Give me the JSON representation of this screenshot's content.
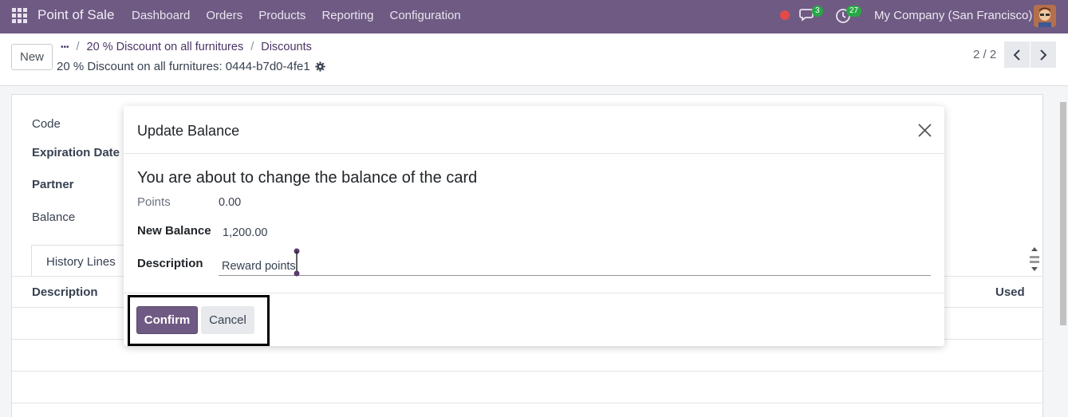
{
  "navbar": {
    "brand": "Point of Sale",
    "menu": [
      "Dashboard",
      "Orders",
      "Products",
      "Reporting",
      "Configuration"
    ],
    "chat_count": "3",
    "activity_count": "27",
    "company": "My Company (San Francisco)"
  },
  "control": {
    "new_label": "New",
    "breadcrumb_more": "•••",
    "breadcrumb": [
      "20 % Discount on all furnitures",
      "Discounts"
    ],
    "separator": "/",
    "record_title": "20 % Discount on all furnitures: 0444-b7d0-4fe1",
    "pager": "2 / 2"
  },
  "form": {
    "code_label": "Code",
    "expiration_label": "Expiration Date",
    "partner_label": "Partner",
    "balance_label": "Balance",
    "tab_history": "History Lines",
    "col_description": "Description",
    "col_used": "Used"
  },
  "dialog": {
    "title": "Update Balance",
    "heading": "You are about to change the balance of the card",
    "points_label": "Points",
    "points_value": "0.00",
    "new_balance_label": "New Balance",
    "new_balance_value": "1,200.00",
    "description_label": "Description",
    "description_value": "Reward points",
    "confirm_label": "Confirm",
    "cancel_label": "Cancel"
  },
  "colors": {
    "brand": "#6f5a83",
    "badge": "#28a745",
    "status_dot": "#e34b4b"
  }
}
